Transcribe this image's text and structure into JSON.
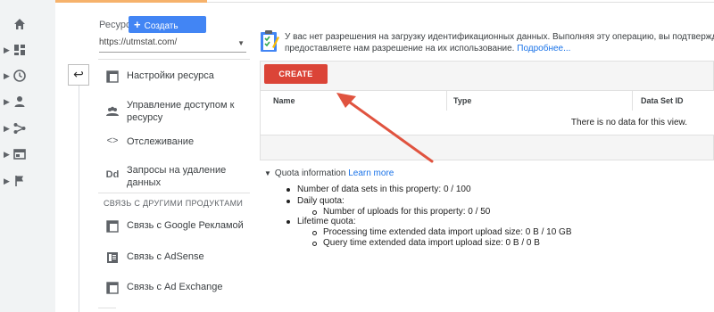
{
  "rail": {
    "items": [
      {
        "name": "home-icon",
        "caret": false
      },
      {
        "name": "dashboard-icon",
        "caret": true
      },
      {
        "name": "clock-icon",
        "caret": true
      },
      {
        "name": "person-icon",
        "caret": true
      },
      {
        "name": "acquisition-icon",
        "caret": true
      },
      {
        "name": "behavior-icon",
        "caret": true
      },
      {
        "name": "flag-icon",
        "caret": true
      }
    ]
  },
  "sidebar": {
    "resource_label": "Ресурс",
    "create_resource_label": "Создать ресурс",
    "property_url": "https://utmstat.com/",
    "items": [
      {
        "label": "Настройки ресурса",
        "icon": "settings-page-icon"
      },
      {
        "label": "Управление доступом к ресурсу",
        "icon": "people-icon"
      },
      {
        "label": "Отслеживание",
        "icon": "code-icon"
      },
      {
        "label": "Запросы на удаление данных",
        "icon": "dd-icon",
        "icon_text": "Dd"
      }
    ],
    "section_heading": "СВЯЗЬ С ДРУГИМИ ПРОДУКТАМИ",
    "links": [
      {
        "label": "Связь с Google Рекламой",
        "icon": "google-ads-icon"
      },
      {
        "label": "Связь с AdSense",
        "icon": "adsense-icon"
      },
      {
        "label": "Связь с Ad Exchange",
        "icon": "ad-exchange-icon"
      }
    ]
  },
  "notice": {
    "line1": "У вас нет разрешения на загрузку идентификационных данных. Выполняя эту операцию, вы подтверждаете",
    "line2": "предоставляете нам разрешение на их использование.",
    "link": "Подробнее..."
  },
  "toolbar": {
    "create_label": "CREATE"
  },
  "table": {
    "columns": [
      "Name",
      "Type",
      "Data Set ID"
    ],
    "empty_text": "There is no data for this view."
  },
  "quota": {
    "title": "Quota information",
    "learn_more": "Learn more",
    "items": [
      {
        "text": "Number of data sets in this property: 0 / 100",
        "level": 1
      },
      {
        "text": "Daily quota:",
        "level": 1
      },
      {
        "text": "Number of uploads for this property: 0 / 50",
        "level": 2
      },
      {
        "text": "Lifetime quota:",
        "level": 1
      },
      {
        "text": "Processing time extended data import upload size: 0 B / 10 GB",
        "level": 2
      },
      {
        "text": "Query time extended data import upload size: 0 B / 0 B",
        "level": 2
      }
    ]
  },
  "colors": {
    "accent_blue": "#4285f4",
    "create_red": "#db4437",
    "annotation_arrow": "#e0533f",
    "link": "#1a73e8"
  }
}
